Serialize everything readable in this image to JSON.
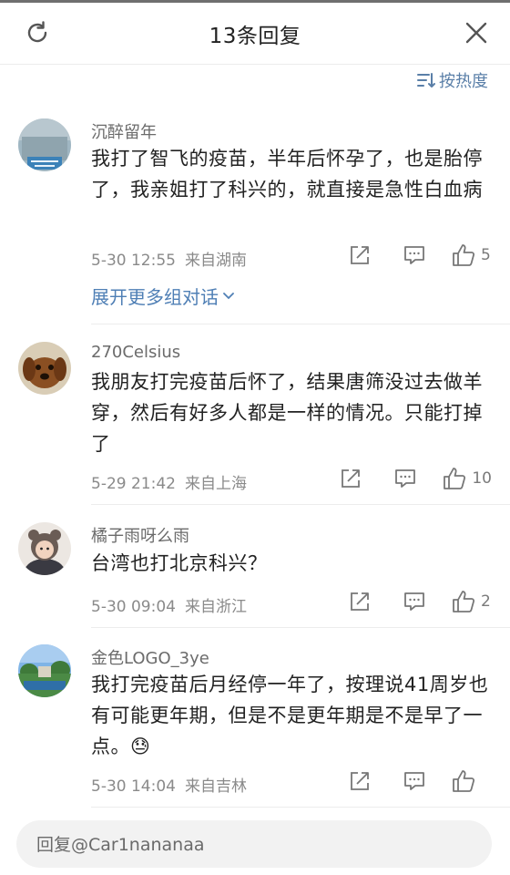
{
  "header": {
    "title": "13条回复",
    "refresh_icon": "refresh-icon",
    "close_icon": "close-icon"
  },
  "sort": {
    "label": "按热度",
    "icon": "sort-lines-icon"
  },
  "comments": [
    {
      "username": "沉醉留年",
      "text": "我打了智飞的疫苗，半年后怀孕了，也是胎停了，我亲姐打了科兴的，就直接是急性白血病",
      "date": "5-30 12:55",
      "location": "来自湖南",
      "likes": "5",
      "expand_label": "展开更多组对话"
    },
    {
      "username": "270Celsius",
      "text": "我朋友打完疫苗后怀了，结果唐筛没过去做羊穿，然后有好多人都是一样的情况。只能打掉了",
      "date": "5-29 21:42",
      "location": "来自上海",
      "likes": "10"
    },
    {
      "username": "橘子雨呀么雨",
      "text": "台湾也打北京科兴？",
      "date": "5-30 09:04",
      "location": "来自浙江",
      "likes": "2"
    },
    {
      "username": "金色LOGO_3ye",
      "text": "我打完疫苗后月经停一年了，按理说41周岁也有可能更年期，但是不是更年期是不是早了一点。😓",
      "date": "5-30 14:04",
      "location": "来自吉林",
      "likes": ""
    }
  ],
  "reply": {
    "placeholder": "回复@Car1nananaa"
  },
  "colors": {
    "link": "#4f7fb5",
    "sort": "#5a7fa8",
    "divider": "#ececec"
  }
}
